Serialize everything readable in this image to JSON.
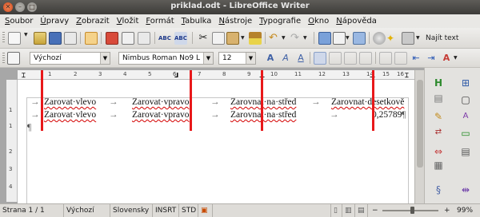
{
  "window": {
    "title": "priklad.odt - LibreOffice Writer"
  },
  "menu": [
    "Soubor",
    "Úpravy",
    "Zobrazit",
    "Vložit",
    "Formát",
    "Tabulka",
    "Nástroje",
    "Typografie",
    "Okno",
    "Nápověda"
  ],
  "toolbar": {
    "find_label": "Najít text",
    "paragraph_style": "Výchozí",
    "font_name": "Nimbus Roman No9 L",
    "font_size": "12"
  },
  "ruler": {
    "numbers": [
      "1",
      "2",
      "3",
      "4",
      "5",
      "6",
      "7",
      "8",
      "9",
      "10",
      "11",
      "12",
      "13",
      "14",
      "15",
      "16"
    ]
  },
  "vruler": {
    "numbers": [
      "1",
      "1",
      "2",
      "3",
      "4"
    ]
  },
  "document": {
    "arrow": "→",
    "pilcrow": "¶",
    "line1": [
      "Zarovat·vlevo",
      "Zarovat·vpravo",
      "Zarovnat·na·střed",
      "Zarovnat·desetkově"
    ],
    "line2": [
      "Zarovat·vlevo",
      "Zarovat·vpravo",
      "Zarovnat·na·střed",
      "0,25789"
    ]
  },
  "statusbar": {
    "page": "Strana 1 / 1",
    "style": "Výchozí",
    "language": "Slovensky",
    "insert": "INSRT",
    "selection": "STD",
    "zoom": "99%"
  },
  "colors": {
    "tab_marker": "#e8181a",
    "spellcheck": "#d40000"
  }
}
